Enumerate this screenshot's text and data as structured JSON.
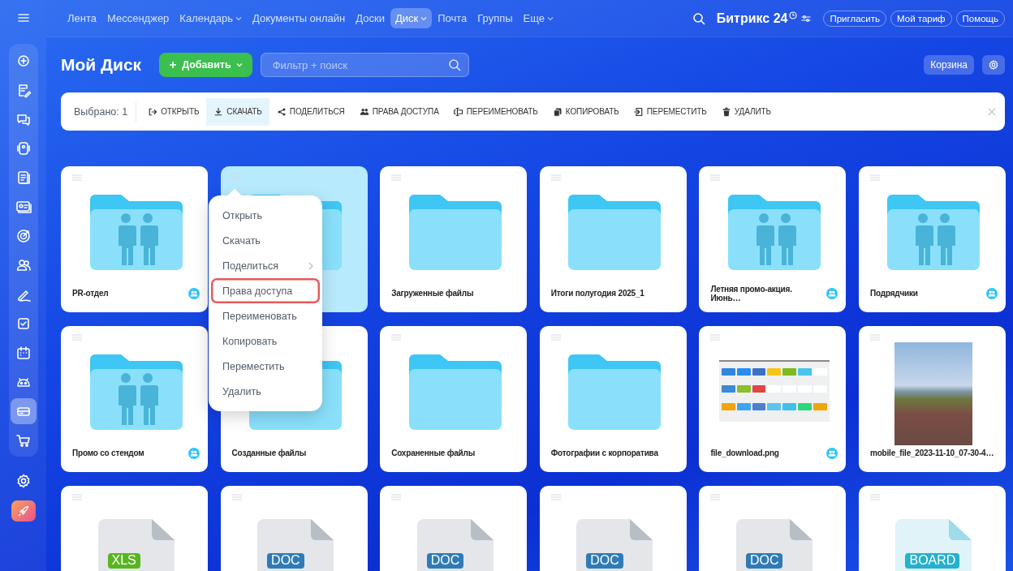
{
  "sidebar": {
    "items": [
      {
        "kind": "feed",
        "selected": false
      },
      {
        "kind": "tasks",
        "selected": false
      },
      {
        "kind": "chat",
        "selected": false
      },
      {
        "kind": "phone",
        "selected": false
      },
      {
        "kind": "docs",
        "selected": false
      },
      {
        "kind": "contact",
        "selected": false
      },
      {
        "kind": "target",
        "selected": false
      },
      {
        "kind": "people",
        "selected": false
      },
      {
        "kind": "pen",
        "selected": false
      },
      {
        "kind": "check",
        "selected": false
      },
      {
        "kind": "calendar",
        "selected": false
      },
      {
        "kind": "robot",
        "selected": false
      },
      {
        "kind": "drive",
        "selected": true
      },
      {
        "kind": "cart",
        "selected": false
      }
    ]
  },
  "top_nav": {
    "items": [
      {
        "label": "Лента",
        "selected": false,
        "has_menu": false
      },
      {
        "label": "Мессенджер",
        "selected": false,
        "has_menu": false
      },
      {
        "label": "Календарь",
        "selected": false,
        "has_menu": true
      },
      {
        "label": "Документы онлайн",
        "selected": false,
        "has_menu": false
      },
      {
        "label": "Доски",
        "selected": false,
        "has_menu": false
      },
      {
        "label": "Диск",
        "selected": true,
        "has_menu": true
      },
      {
        "label": "Почта",
        "selected": false,
        "has_menu": false
      },
      {
        "label": "Группы",
        "selected": false,
        "has_menu": false
      },
      {
        "label": "Еще",
        "selected": false,
        "has_menu": true
      }
    ],
    "logo": "Битрикс 24",
    "buttons": [
      "Пригласить",
      "Мой тариф",
      "Помощь"
    ]
  },
  "header": {
    "title": "Мой Диск",
    "add_button": "Добавить",
    "search": {
      "placeholder": "Фильтр + поиск"
    },
    "trash_button": "Корзина"
  },
  "action_bar": {
    "selected_count": "Выбрано: 1",
    "actions": [
      {
        "kind": "open",
        "label": "ОТКРЫТЬ",
        "active": false
      },
      {
        "kind": "download",
        "label": "СКАЧАТЬ",
        "active": true
      },
      {
        "kind": "share",
        "label": "ПОДЕЛИТЬСЯ",
        "active": false
      },
      {
        "kind": "access",
        "label": "ПРАВА ДОСТУПА",
        "active": false
      },
      {
        "kind": "rename",
        "label": "ПЕРЕИМЕНОВАТЬ",
        "active": false
      },
      {
        "kind": "copy",
        "label": "КОПИРОВАТЬ",
        "active": false
      },
      {
        "kind": "move",
        "label": "ПЕРЕМЕСТИТЬ",
        "active": false
      },
      {
        "kind": "delete",
        "label": "УДАЛИТЬ",
        "active": false
      }
    ]
  },
  "files": [
    {
      "kind": "group_folder",
      "name": "PR-отдел",
      "shared": true,
      "selected": false,
      "handle": true
    },
    {
      "kind": "folder",
      "selected": true,
      "shared": false,
      "handle": true
    },
    {
      "kind": "folder",
      "name": "Загруженные файлы",
      "shared": false,
      "selected": false,
      "handle": true
    },
    {
      "kind": "folder",
      "name": "Итоги полугодия 2025_1",
      "shared": false,
      "selected": false,
      "handle": true
    },
    {
      "kind": "group_folder",
      "name": "Летняя промо-акция. Июнь…",
      "shared": true,
      "selected": false,
      "handle": true
    },
    {
      "kind": "group_folder",
      "name": "Подрядчики",
      "shared": true,
      "selected": false,
      "handle": true
    },
    {
      "kind": "group_folder",
      "name": "Промо со стендом",
      "shared": true,
      "selected": false,
      "handle": true
    },
    {
      "kind": "folder",
      "name": "Созданные файлы",
      "shared": false,
      "selected": false,
      "handle": false
    },
    {
      "kind": "folder",
      "name": "Сохраненные файлы",
      "shared": false,
      "selected": false,
      "handle": true
    },
    {
      "kind": "folder",
      "name": "Фотографии с корпоратива",
      "shared": false,
      "selected": false,
      "handle": true
    },
    {
      "kind": "screenshot",
      "name": "file_download.png",
      "shared": true,
      "selected": false,
      "handle": true
    },
    {
      "kind": "photo",
      "name": "mobile_file_2023-11-10_07-30-4…",
      "shared": false,
      "selected": false,
      "handle": true
    },
    {
      "kind": "document",
      "badge": "XLS",
      "color": "#57b51f",
      "selected": false,
      "shared": false,
      "handle": true
    },
    {
      "kind": "document",
      "badge": "DOC",
      "color": "#2f7bb8",
      "selected": false,
      "shared": false,
      "handle": true
    },
    {
      "kind": "document",
      "badge": "DOC",
      "color": "#2f7bb8",
      "selected": false,
      "shared": false,
      "handle": true
    },
    {
      "kind": "document",
      "badge": "DOC",
      "color": "#2f7bb8",
      "selected": false,
      "shared": false,
      "handle": true
    },
    {
      "kind": "document",
      "badge": "DOC",
      "color": "#2f7bb8",
      "selected": false,
      "shared": false,
      "handle": true
    },
    {
      "kind": "board",
      "badge": "BOARD",
      "color": "#25b0cf",
      "selected": false,
      "shared": false,
      "handle": true
    }
  ],
  "context_menu": {
    "items": [
      {
        "label": "Открыть",
        "highlighted": false,
        "has_submenu": false
      },
      {
        "label": "Скачать",
        "highlighted": false,
        "has_submenu": false
      },
      {
        "label": "Поделиться",
        "highlighted": false,
        "has_submenu": true
      },
      {
        "label": "Права доступа",
        "highlighted": true,
        "has_submenu": false
      },
      {
        "label": "Переименовать",
        "highlighted": false,
        "has_submenu": false
      },
      {
        "label": "Копировать",
        "highlighted": false,
        "has_submenu": false
      },
      {
        "label": "Переместить",
        "highlighted": false,
        "has_submenu": false
      },
      {
        "label": "Удалить",
        "highlighted": false,
        "has_submenu": false
      }
    ]
  }
}
